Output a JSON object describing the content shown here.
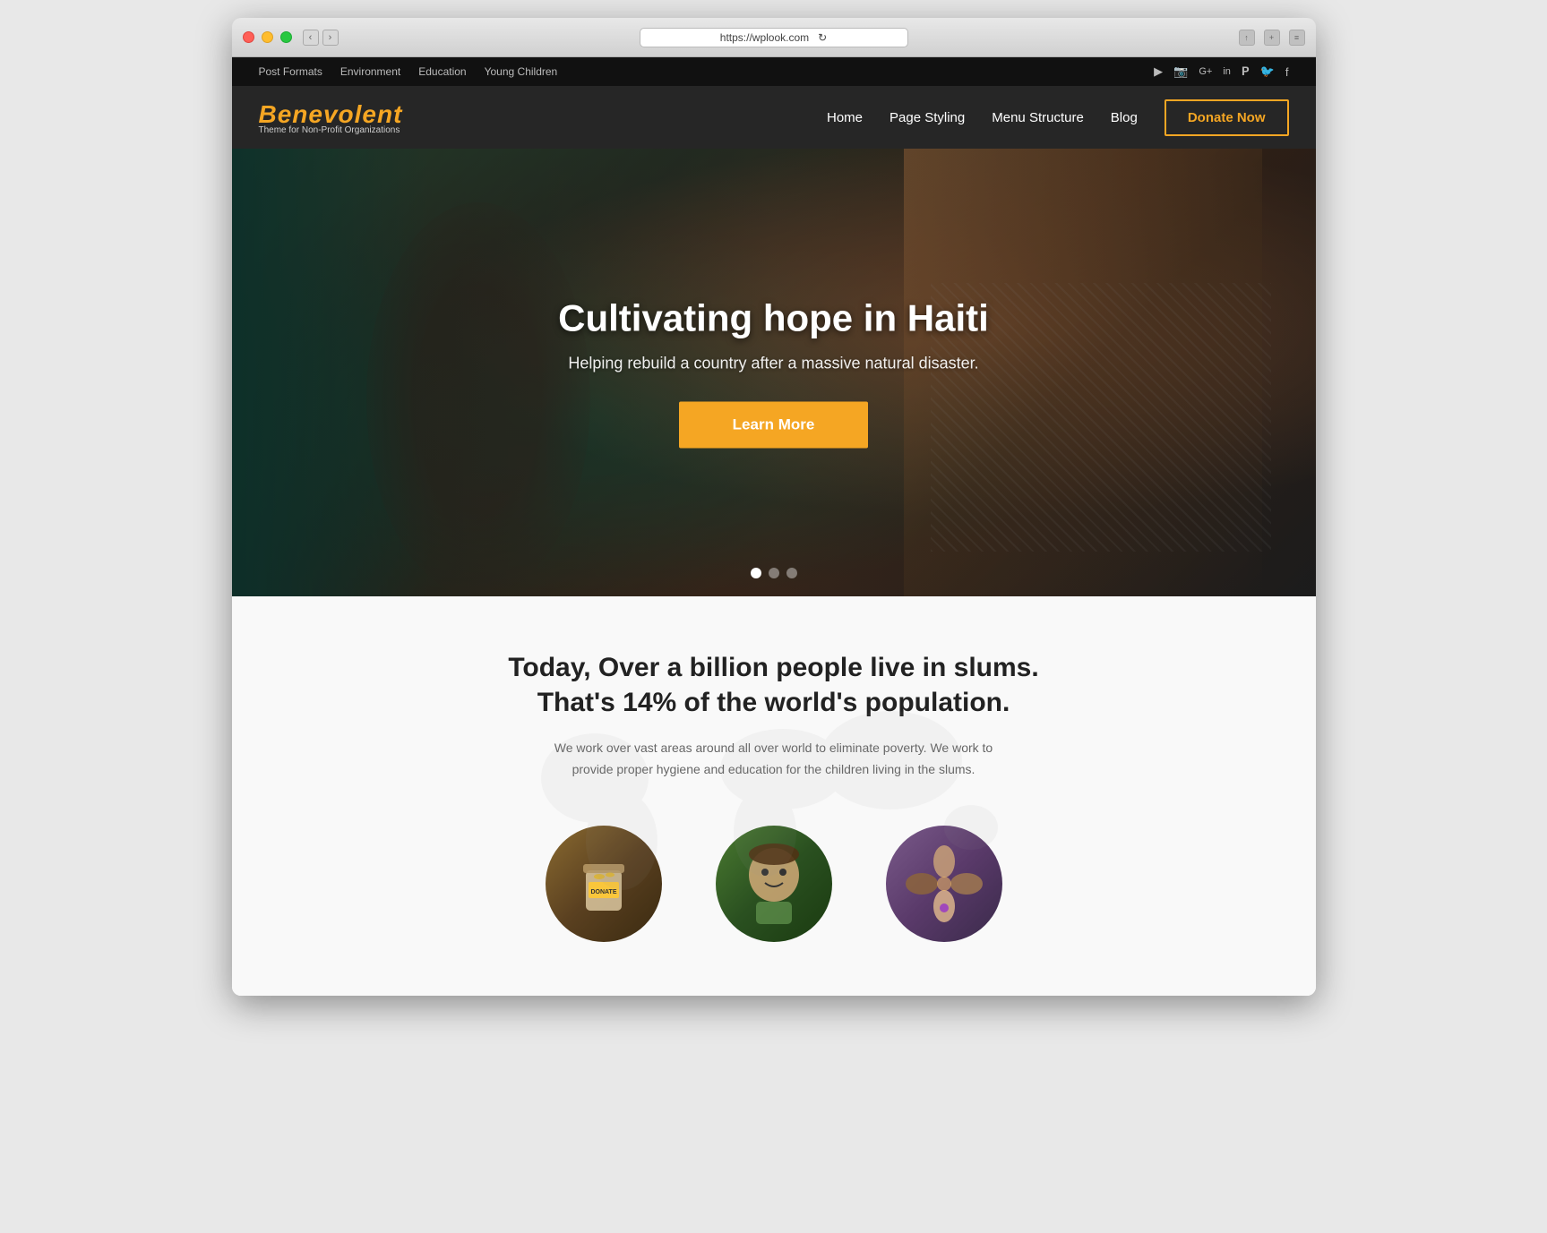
{
  "window": {
    "url": "https://wplook.com",
    "refresh_icon": "↻"
  },
  "admin_bar": {
    "links": [
      "Post Formats",
      "Environment",
      "Education",
      "Young Children"
    ],
    "social_icons": [
      "▶",
      "📷",
      "G+",
      "in",
      "𝐏",
      "🐦",
      "f"
    ]
  },
  "nav": {
    "logo": "Benevolent",
    "tagline": "Theme for Non-Profit Organizations",
    "links": [
      "Home",
      "Page Styling",
      "Menu Structure",
      "Blog"
    ],
    "donate_btn": "Donate Now"
  },
  "hero": {
    "title": "Cultivating hope in Haiti",
    "subtitle": "Helping rebuild a country after a massive natural disaster.",
    "cta_label": "Learn More",
    "dots": [
      true,
      false,
      false
    ]
  },
  "content": {
    "heading_line1": "Today, Over a billion people live in slums.",
    "heading_line2": "That's 14% of the world's population.",
    "description": "We work over vast areas around all over world to eliminate poverty. We work to provide proper hygiene and education for the children living in the slums.",
    "cards": [
      {
        "type": "donate-jar",
        "bg": "#6a4a20"
      },
      {
        "type": "child-portrait",
        "bg": "#3a6a20"
      },
      {
        "type": "hands-together",
        "bg": "#5a3a6a"
      }
    ]
  },
  "colors": {
    "accent": "#f5a623",
    "dark_bg": "#111111",
    "nav_bg": "#1a1a1a",
    "white": "#ffffff",
    "text_dark": "#222222",
    "text_light": "#666666"
  }
}
